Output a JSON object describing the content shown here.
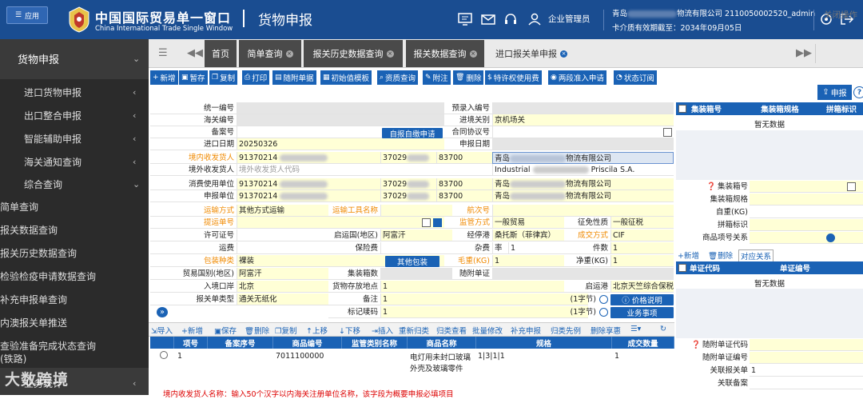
{
  "header": {
    "app_menu": "应用",
    "title_cn": "中国国际贸易单一窗口",
    "title_en": "China International Trade Single Window",
    "subtitle": "货物申报",
    "role": "企业管理员",
    "company_prefix": "青岛",
    "company_suffix": "物流有限公司 2110050002520_admin",
    "card_label": "卡介质有效期截至：",
    "card_date": "2034年09月05日"
  },
  "sidebar": {
    "section": "货物申报",
    "items": [
      "进口货物申报",
      "出口整合申报",
      "智能辅助申报",
      "海关通知查询",
      "综合查询"
    ],
    "sub": [
      "简单查询",
      "报关数据查询",
      "报关历史数据查询",
      "检验检疫申请数据查询",
      "补充申报单查询",
      "内澳报关单推送"
    ],
    "last1": "查验准备完成状态查询",
    "last2": "(铁路)",
    "watermark": "大数跨境",
    "last_item": "业务统计"
  },
  "tabs": [
    "首页",
    "简单查询",
    "报关历史数据查询",
    "报关数据查询",
    "进口报关单申报"
  ],
  "close_ops": "关闭操作",
  "toolbar": [
    "新增",
    "暂存",
    "复制",
    "打印",
    "随附单据",
    "初始值模板",
    "资质查询",
    "附注",
    "删除",
    "特许权使用费",
    "两段准入申请",
    "状态订阅"
  ],
  "declare_btn": "申报",
  "help": "?",
  "form": {
    "l_tongyi": "统一编号",
    "l_yulu": "预录入编号",
    "l_haiguan": "海关编号",
    "l_jingchu": "进境关别",
    "v_jingchu": "京机场关",
    "l_beian": "备案号",
    "b_zishen": "自报自缴申请",
    "l_hetong": "合同协议号",
    "l_date": "进口日期",
    "v_date": "20250326",
    "l_shenbao_date": "申报日期",
    "l_jnshf": "境内收发货人",
    "v_code": "91370214",
    "v_37029": "37029",
    "v_83700": "83700",
    "v_qingdao": "青岛",
    "v_wl": "物流有限公司",
    "l_jwshf": "境外收发货人",
    "p_jwshf": "境外收发货人代码",
    "v_ind": "Industrial",
    "v_pris": "Priscila S.A.",
    "l_xfsy": "消费使用单位",
    "l_sbdw": "申报单位",
    "l_ysfs": "运输方式",
    "v_ysfs": "其他方式运输",
    "l_ysgj": "运输工具名称",
    "l_hc": "航次号",
    "l_tydh": "提运单号",
    "l_jgfs": "监管方式",
    "v_jgfs": "一般贸易",
    "l_zm": "征免性质",
    "v_zm": "一般征税",
    "l_xkz": "许可证号",
    "l_qyg": "启运国(地区)",
    "v_qyg": "阿富汗",
    "l_jtg": "经停港",
    "v_jtg": "桑托斯（菲律宾）",
    "l_cjfs": "成交方式",
    "v_cjfs": "CIF",
    "l_yf": "运费",
    "l_bxf": "保险费",
    "l_zf": "杂费",
    "v_lv": "率",
    "v_one": "1",
    "l_js": "件数",
    "v_js": "1",
    "l_bzzl": "包装种类",
    "v_bzzl": "裸装",
    "b_qtbz": "其他包装",
    "l_mz": "毛重(KG)",
    "v_mz": "1",
    "l_jz": "净重(KG)",
    "v_jz": "1",
    "l_mygb": "贸易国别(地区)",
    "v_mygb": "阿富汗",
    "l_jzxs": "集装箱数",
    "l_sfdz": "随附单证",
    "l_rjka": "入境口岸",
    "v_rjka": "北京",
    "l_hwcf": "货物存放地点",
    "v_hwcf": "1",
    "l_qyg2": "启运港",
    "v_qyg2": "北京天竺综合保税",
    "l_bgdlx": "报关单类型",
    "v_bgdlx": "通关无纸化",
    "l_bz": "备注",
    "v_bz": "1",
    "v_zj": "(1字节)",
    "b_jgsm": "价格说明",
    "l_bjmh": "标记唛码",
    "v_bjmh": "1",
    "v_zj2": "(1字节)",
    "b_ywsx": "业务事项"
  },
  "right": {
    "h_box": "集装箱号",
    "h_spec": "集装箱规格",
    "h_mark": "拼箱标识",
    "nodata": "暂无数据",
    "l_box": "集装箱号",
    "l_spec": "集装箱规格",
    "l_wt": "自重(KG)",
    "l_pxbs": "拼箱标识",
    "l_spxh": "商品项号关系",
    "b_add": "新增",
    "b_del": "删除",
    "b_rel": "对应关系",
    "h_dcode": "单证代码",
    "h_dno": "单证编号",
    "nodata2": "暂无数据",
    "l_sfdm": "随附单证代码",
    "l_sfbh": "随附单证编号",
    "l_gldh": "关联报关单",
    "v_gldh": "1",
    "l_glba": "关联备案"
  },
  "grid_toolbar": [
    "导入",
    "新增",
    "保存",
    "删除",
    "复制",
    "上移",
    "下移",
    "插入",
    "重新归类",
    "归类查看",
    "批量修改",
    "补充申报",
    "归类先例",
    "删除享惠"
  ],
  "grid": {
    "cols": [
      "项号",
      "备案序号",
      "商品编号",
      "监管类别名称",
      "商品名称",
      "规格",
      "成交数量"
    ],
    "row": {
      "no": "1",
      "code": "7011100000",
      "name1": "电灯用未封口玻璃",
      "name2": "外壳及玻璃零件",
      "spec": "1|3|1|1",
      "qty": "1"
    }
  },
  "footer": "境内收发货人名称：输入50个汉字以内海关注册单位名称，该字段为概要申报必填项目"
}
